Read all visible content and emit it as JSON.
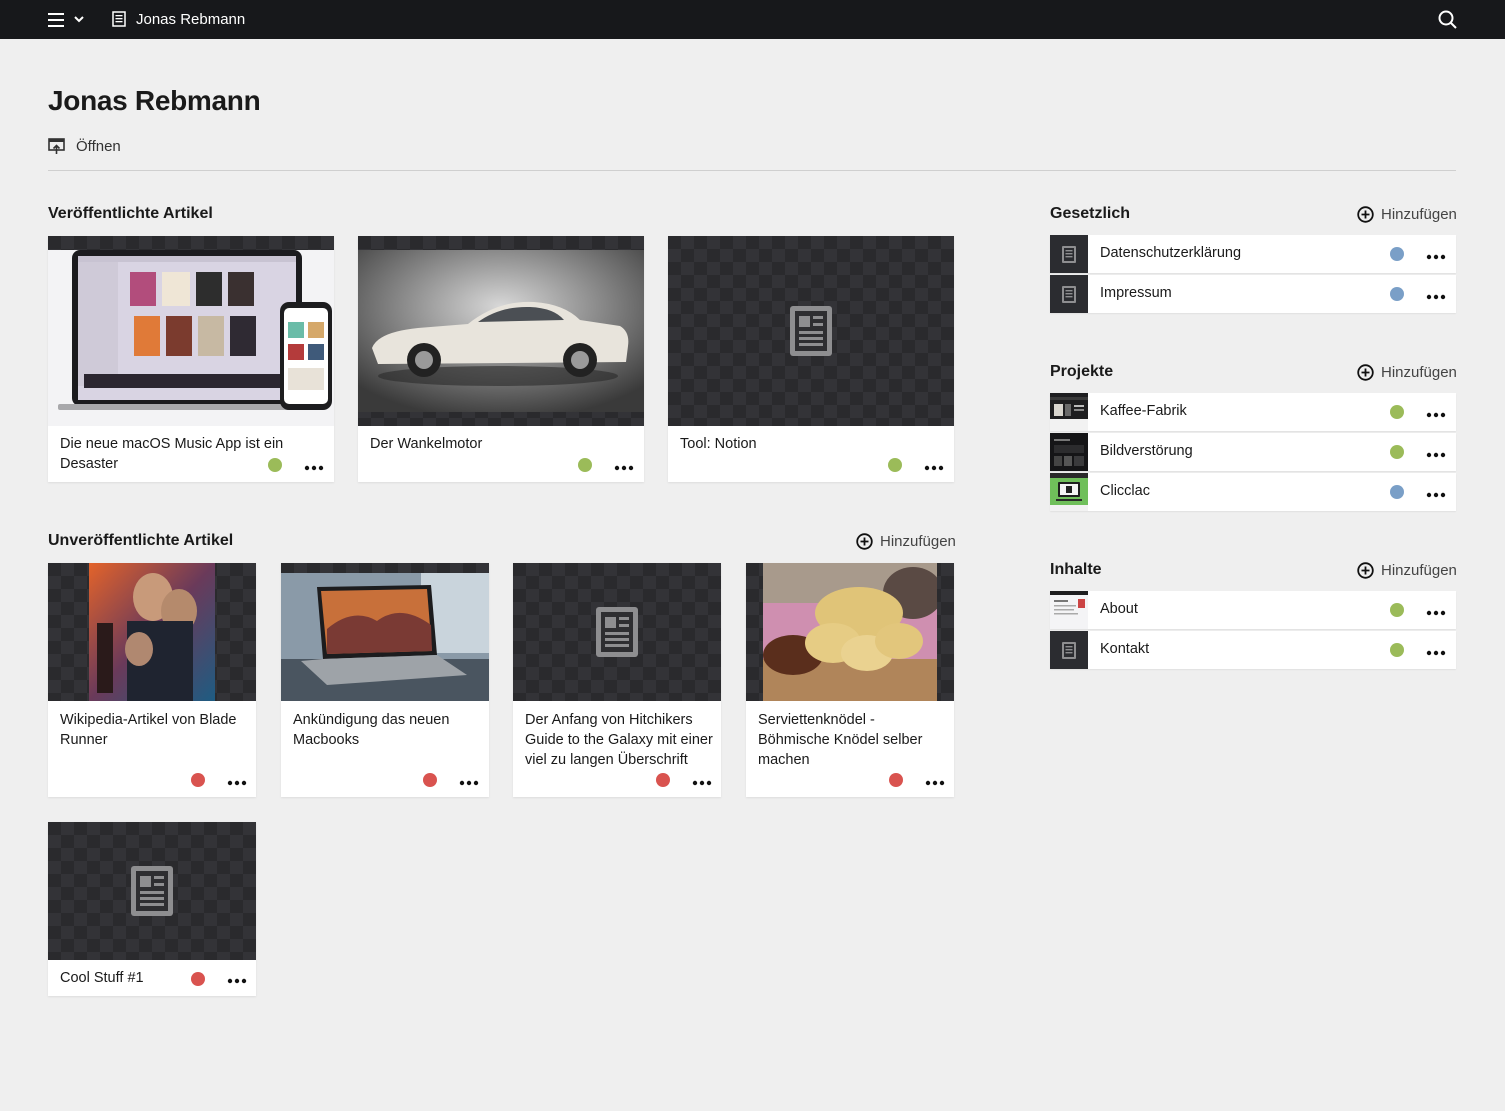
{
  "topbar": {
    "title": "Jonas Rebmann"
  },
  "page": {
    "title": "Jonas Rebmann",
    "open_label": "Öffnen"
  },
  "colors": {
    "published": "#9bbb59",
    "unpublished": "#d9534f",
    "neutral": "#7a9fc7",
    "topbar": "#17181b"
  },
  "published": {
    "title": "Veröffentlichte Artikel",
    "items": [
      {
        "title": "Die neue macOS Music App ist ein Desaster",
        "status": "published",
        "thumb": "laptop-phone-image"
      },
      {
        "title": "Der Wankelmotor",
        "status": "published",
        "thumb": "car-image"
      },
      {
        "title": "Tool: Notion",
        "status": "published",
        "thumb": "document-placeholder"
      }
    ]
  },
  "unpublished": {
    "title": "Unveröffentlichte Artikel",
    "add_label": "Hinzufügen",
    "items": [
      {
        "title": "Wikipedia-Artikel von Blade Runner",
        "status": "unpublished",
        "thumb": "movie-poster-image"
      },
      {
        "title": "Ankündigung das neuen Macbooks",
        "status": "unpublished",
        "thumb": "macbook-image"
      },
      {
        "title": "Der Anfang von Hitchikers Guide to the Galaxy mit einer viel zu langen Überschrift",
        "status": "unpublished",
        "thumb": "document-placeholder"
      },
      {
        "title": "Serviettenknödel - Böhmische Knödel selber machen",
        "status": "unpublished",
        "thumb": "food-image"
      },
      {
        "title": "Cool Stuff #1",
        "status": "unpublished",
        "thumb": "document-placeholder"
      }
    ]
  },
  "legal": {
    "title": "Gesetzlich",
    "add_label": "Hinzufügen",
    "items": [
      {
        "label": "Datenschutzerklärung",
        "status": "neutral"
      },
      {
        "label": "Impressum",
        "status": "neutral"
      }
    ]
  },
  "projects": {
    "title": "Projekte",
    "add_label": "Hinzufügen",
    "items": [
      {
        "label": "Kaffee-Fabrik",
        "status": "published"
      },
      {
        "label": "Bildverstörung",
        "status": "published"
      },
      {
        "label": "Clicclac",
        "status": "neutral"
      }
    ]
  },
  "contents": {
    "title": "Inhalte",
    "add_label": "Hinzufügen",
    "items": [
      {
        "label": "About",
        "status": "published"
      },
      {
        "label": "Kontakt",
        "status": "published"
      }
    ]
  }
}
